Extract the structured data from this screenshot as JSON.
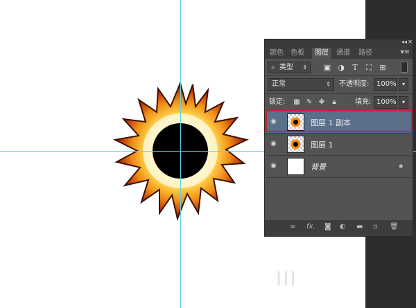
{
  "tabs": [
    "颜色",
    "色板",
    "图层",
    "通道",
    "路径"
  ],
  "active_tab": "图层",
  "filter": {
    "label": "类型"
  },
  "blend_mode": {
    "value": "正常"
  },
  "opacity": {
    "label": "不透明度:",
    "value": "100%"
  },
  "lock": {
    "label": "锁定:"
  },
  "fill": {
    "label": "填充:",
    "value": "100%"
  },
  "layers": [
    {
      "name": "图层 1 副本",
      "selected": true
    },
    {
      "name": "图层 1",
      "selected": false
    },
    {
      "name": "背景",
      "selected": false,
      "locked": true
    }
  ],
  "bottom_bar": {
    "fx_label": "fx."
  },
  "watermark": "III",
  "colors": {
    "panel": "#535353",
    "selection": "#596f8a",
    "highlight_frame": "#c0272d",
    "guide": "#5fd3e3"
  },
  "icons": [
    "collapse-icon",
    "panel-menu-icon",
    "search-icon",
    "image-filter-icon",
    "adjustment-filter-icon",
    "text-filter-icon",
    "shape-filter-icon",
    "smart-object-filter-icon",
    "toggle-filter-icon",
    "eye-icon",
    "lock-icon",
    "link-icon",
    "mask-icon",
    "new-group-icon",
    "new-layer-icon",
    "trash-icon"
  ]
}
